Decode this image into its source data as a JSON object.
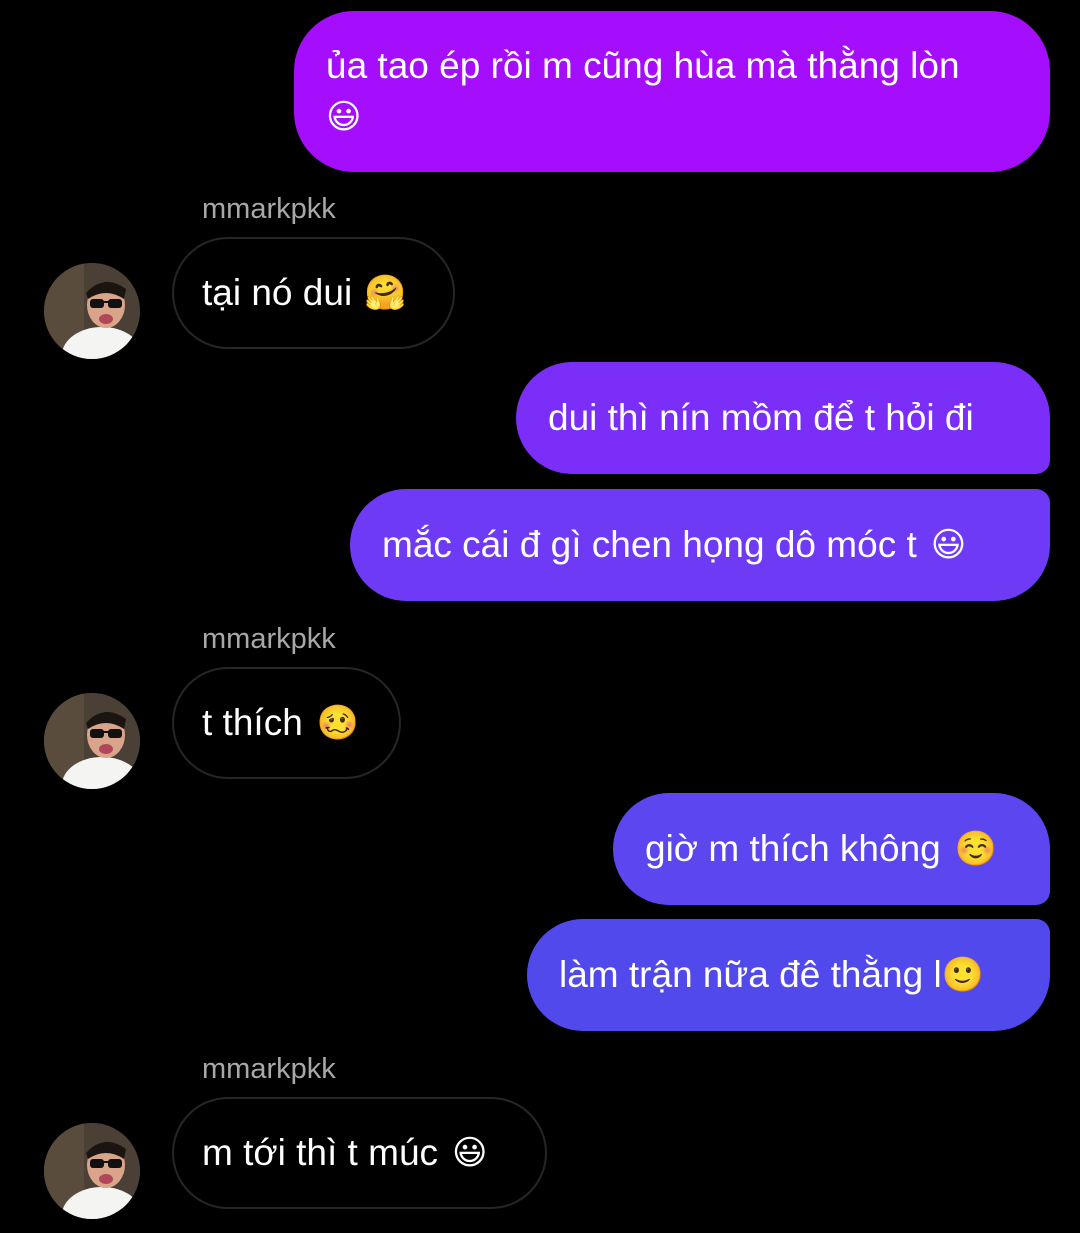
{
  "contact": {
    "username": "mmarkpkk"
  },
  "messages": [
    {
      "direction": "sent",
      "text": "ủa tao ép rồi m cũng hùa mà thằng lòn",
      "emoji": "😃"
    },
    {
      "direction": "received",
      "sender": "mmarkpkk",
      "text": "tại nó dui",
      "emoji": "🤗"
    },
    {
      "direction": "sent",
      "text": "dui thì nín mồm để t hỏi đi",
      "emoji": ""
    },
    {
      "direction": "sent",
      "text": "mắc cái đ gì chen họng dô móc t",
      "emoji": "😃"
    },
    {
      "direction": "received",
      "sender": "mmarkpkk",
      "text": "t thích",
      "emoji": "🥴"
    },
    {
      "direction": "sent",
      "text": "giờ m thích không",
      "emoji": "☺️"
    },
    {
      "direction": "sent",
      "text": "làm trận nữa đê thằng l",
      "emoji": "🙂"
    },
    {
      "direction": "received",
      "sender": "mmarkpkk",
      "text": "m tới thì t múc",
      "emoji": "😃"
    }
  ],
  "colors": {
    "background": "#000000",
    "sent_gradient_top": "#a50efc",
    "sent_gradient_mid": "#7a38f7",
    "sent_gradient_bottom": "#5448ee",
    "received_border": "#262626",
    "username_text": "#a8a8a8"
  },
  "icons": {
    "avatar": "profile-photo"
  }
}
